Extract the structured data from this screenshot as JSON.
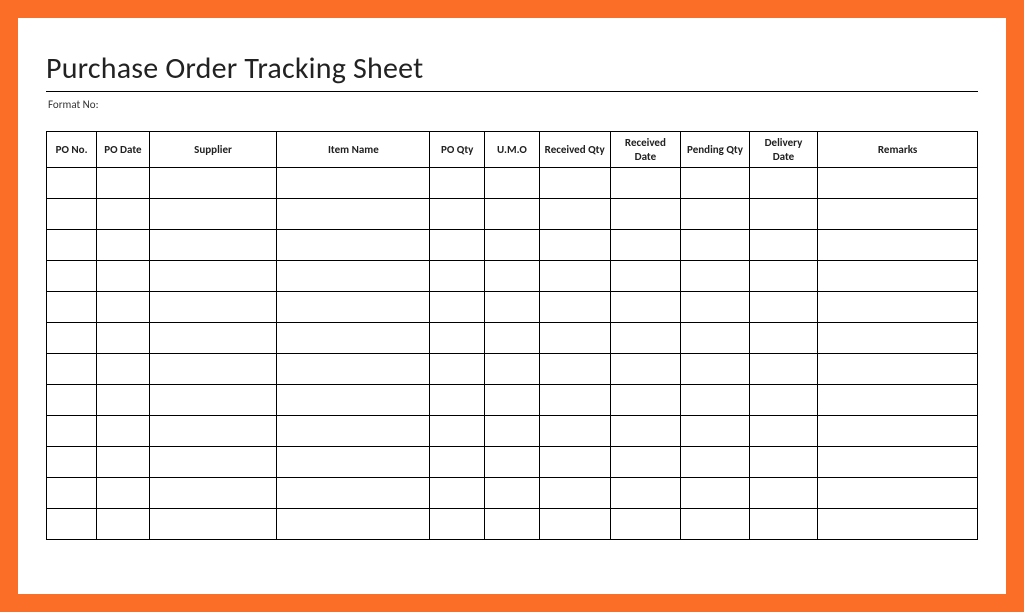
{
  "title": "Purchase Order Tracking Sheet",
  "format_label": "Format No:",
  "columns": [
    {
      "key": "po_no",
      "label": "PO No."
    },
    {
      "key": "po_date",
      "label": "PO Date"
    },
    {
      "key": "supplier",
      "label": "Supplier"
    },
    {
      "key": "item_name",
      "label": "Item Name"
    },
    {
      "key": "po_qty",
      "label": "PO Qty"
    },
    {
      "key": "umo",
      "label": "U.M.O"
    },
    {
      "key": "recv_qty",
      "label": "Received Qty"
    },
    {
      "key": "recv_date",
      "label": "Received Date"
    },
    {
      "key": "pend_qty",
      "label": "Pending Qty"
    },
    {
      "key": "del_date",
      "label": "Delivery Date"
    },
    {
      "key": "remarks",
      "label": "Remarks"
    }
  ],
  "rows": [
    {
      "po_no": "",
      "po_date": "",
      "supplier": "",
      "item_name": "",
      "po_qty": "",
      "umo": "",
      "recv_qty": "",
      "recv_date": "",
      "pend_qty": "",
      "del_date": "",
      "remarks": ""
    },
    {
      "po_no": "",
      "po_date": "",
      "supplier": "",
      "item_name": "",
      "po_qty": "",
      "umo": "",
      "recv_qty": "",
      "recv_date": "",
      "pend_qty": "",
      "del_date": "",
      "remarks": ""
    },
    {
      "po_no": "",
      "po_date": "",
      "supplier": "",
      "item_name": "",
      "po_qty": "",
      "umo": "",
      "recv_qty": "",
      "recv_date": "",
      "pend_qty": "",
      "del_date": "",
      "remarks": ""
    },
    {
      "po_no": "",
      "po_date": "",
      "supplier": "",
      "item_name": "",
      "po_qty": "",
      "umo": "",
      "recv_qty": "",
      "recv_date": "",
      "pend_qty": "",
      "del_date": "",
      "remarks": ""
    },
    {
      "po_no": "",
      "po_date": "",
      "supplier": "",
      "item_name": "",
      "po_qty": "",
      "umo": "",
      "recv_qty": "",
      "recv_date": "",
      "pend_qty": "",
      "del_date": "",
      "remarks": ""
    },
    {
      "po_no": "",
      "po_date": "",
      "supplier": "",
      "item_name": "",
      "po_qty": "",
      "umo": "",
      "recv_qty": "",
      "recv_date": "",
      "pend_qty": "",
      "del_date": "",
      "remarks": ""
    },
    {
      "po_no": "",
      "po_date": "",
      "supplier": "",
      "item_name": "",
      "po_qty": "",
      "umo": "",
      "recv_qty": "",
      "recv_date": "",
      "pend_qty": "",
      "del_date": "",
      "remarks": ""
    },
    {
      "po_no": "",
      "po_date": "",
      "supplier": "",
      "item_name": "",
      "po_qty": "",
      "umo": "",
      "recv_qty": "",
      "recv_date": "",
      "pend_qty": "",
      "del_date": "",
      "remarks": ""
    },
    {
      "po_no": "",
      "po_date": "",
      "supplier": "",
      "item_name": "",
      "po_qty": "",
      "umo": "",
      "recv_qty": "",
      "recv_date": "",
      "pend_qty": "",
      "del_date": "",
      "remarks": ""
    },
    {
      "po_no": "",
      "po_date": "",
      "supplier": "",
      "item_name": "",
      "po_qty": "",
      "umo": "",
      "recv_qty": "",
      "recv_date": "",
      "pend_qty": "",
      "del_date": "",
      "remarks": ""
    },
    {
      "po_no": "",
      "po_date": "",
      "supplier": "",
      "item_name": "",
      "po_qty": "",
      "umo": "",
      "recv_qty": "",
      "recv_date": "",
      "pend_qty": "",
      "del_date": "",
      "remarks": ""
    },
    {
      "po_no": "",
      "po_date": "",
      "supplier": "",
      "item_name": "",
      "po_qty": "",
      "umo": "",
      "recv_qty": "",
      "recv_date": "",
      "pend_qty": "",
      "del_date": "",
      "remarks": ""
    }
  ]
}
